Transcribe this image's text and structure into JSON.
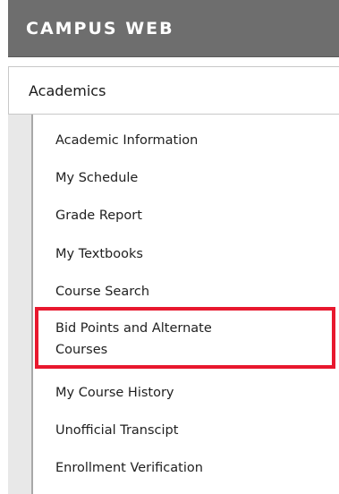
{
  "header": {
    "title": "CAMPUS WEB"
  },
  "section": {
    "title": "Academics"
  },
  "menu": {
    "items": [
      "Academic Information",
      "My Schedule",
      "Grade Report",
      "My Textbooks",
      "Course Search",
      "Bid Points and Alternate Courses",
      "My Course History",
      "Unofficial Transcipt",
      "Enrollment Verification"
    ],
    "highlighted_index": 5
  },
  "colors": {
    "header_background": "#6e6e6e",
    "highlight_border": "#e8182e"
  }
}
